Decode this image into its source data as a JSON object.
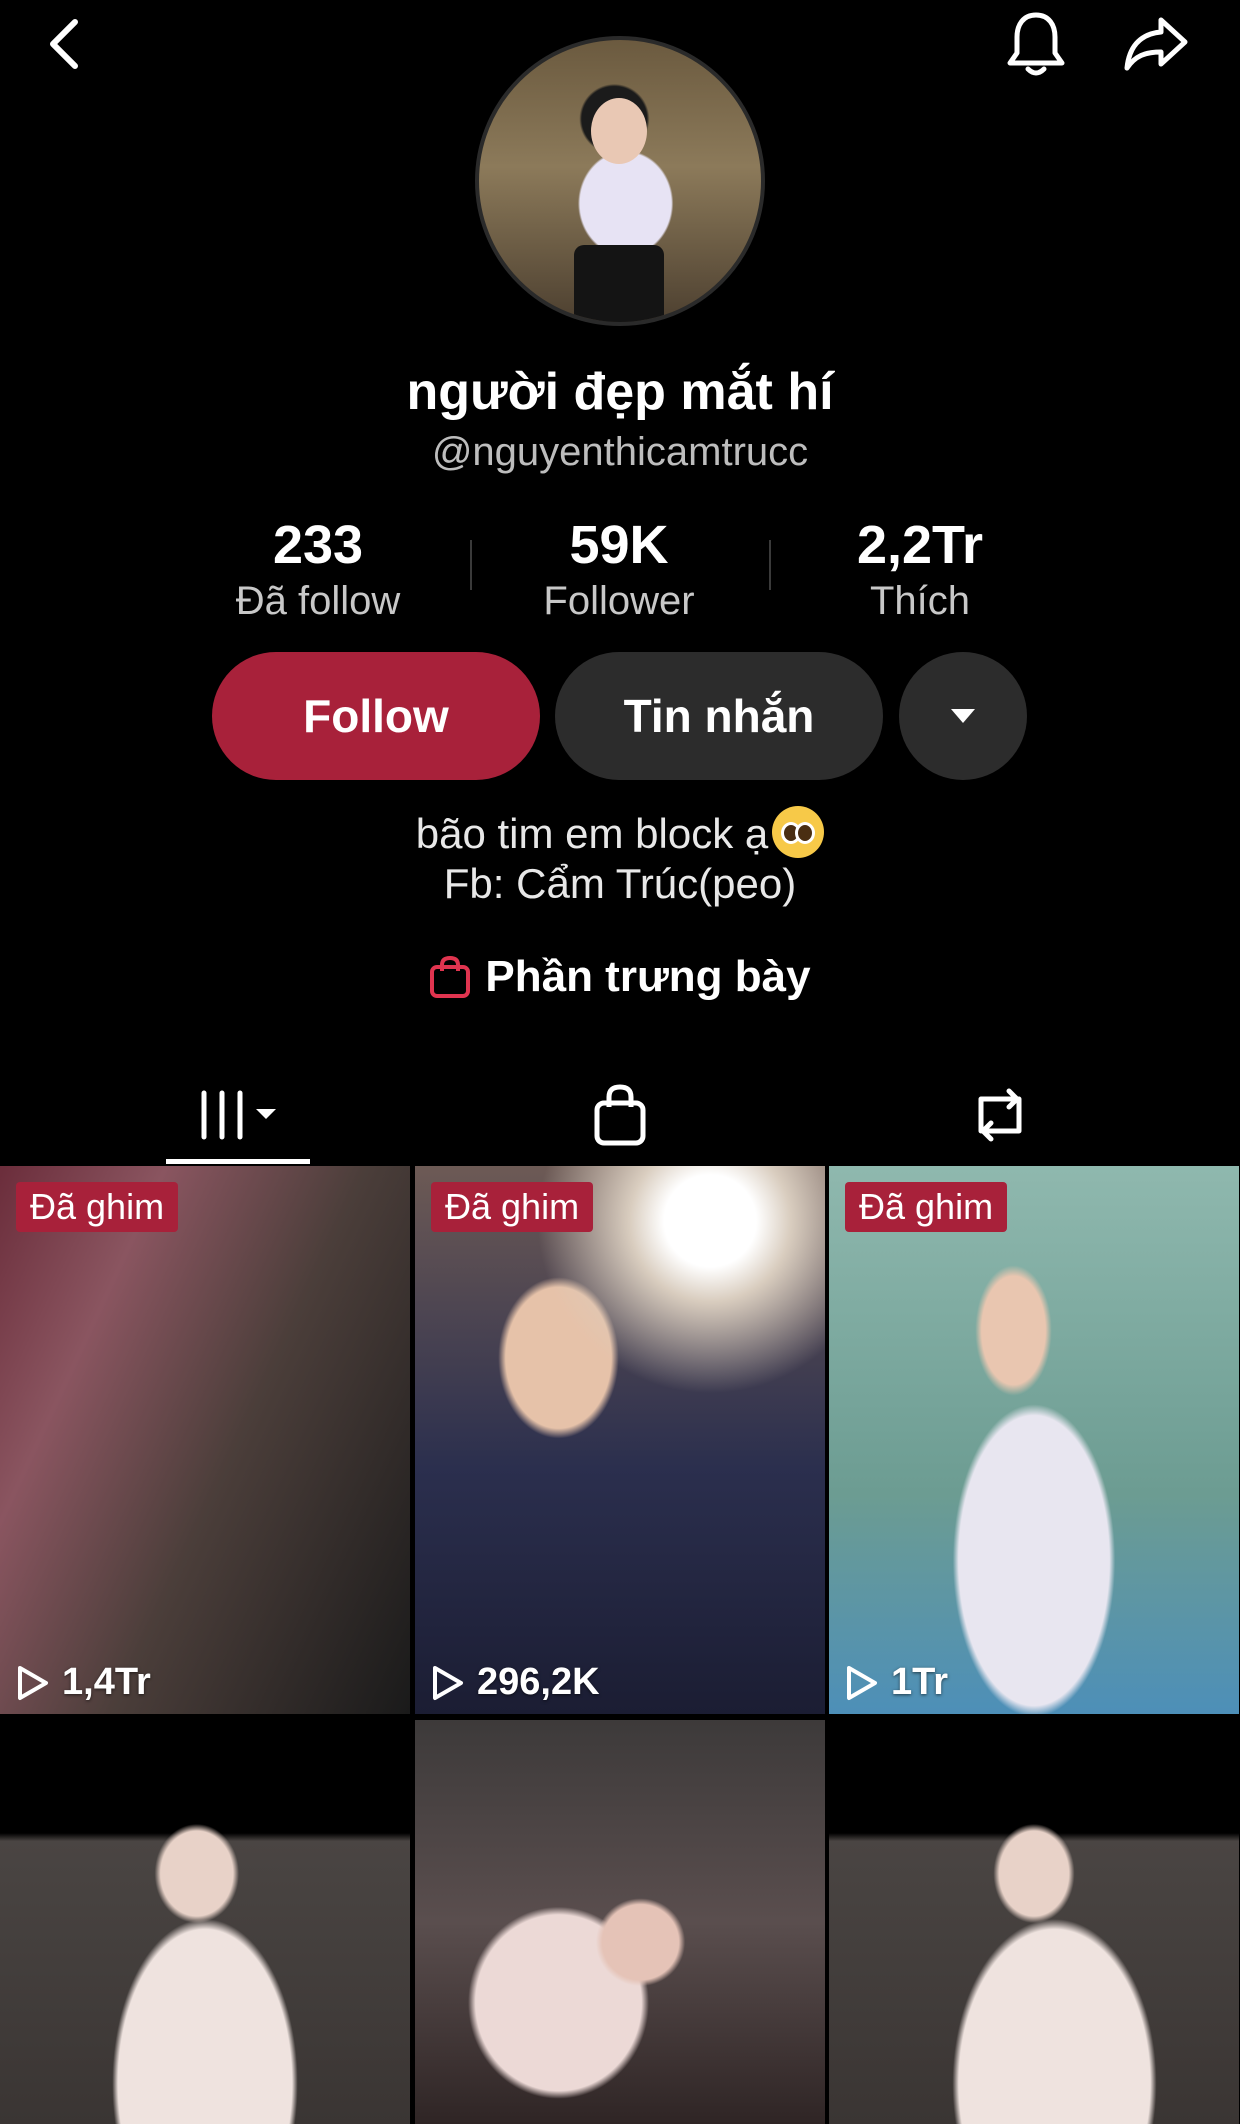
{
  "profile": {
    "display_name": "người đẹp mắt hí",
    "username": "@nguyenthicamtrucc"
  },
  "stats": [
    {
      "value": "233",
      "label": "Đã follow"
    },
    {
      "value": "59K",
      "label": "Follower"
    },
    {
      "value": "2,2Tr",
      "label": "Thích"
    }
  ],
  "actions": {
    "follow_label": "Follow",
    "message_label": "Tin nhắn"
  },
  "bio": {
    "line1": "bão tim em block ạ",
    "line2": "Fb: Cẩm Trúc(peo)"
  },
  "showcase_label": "Phần trưng bày",
  "tabs": [
    "videos-grid-icon",
    "shop-bag-icon",
    "repost-icon"
  ],
  "videos": [
    {
      "pinned_label": "Đã ghim",
      "views": "1,4Tr"
    },
    {
      "pinned_label": "Đã ghim",
      "views": "296,2K"
    },
    {
      "pinned_label": "Đã ghim",
      "views": "1Tr"
    },
    {
      "views": ""
    },
    {
      "views": ""
    },
    {
      "views": ""
    }
  ],
  "colors": {
    "background": "#000000",
    "accent": "#a8213a",
    "secondary_button": "#2c2c2c"
  }
}
